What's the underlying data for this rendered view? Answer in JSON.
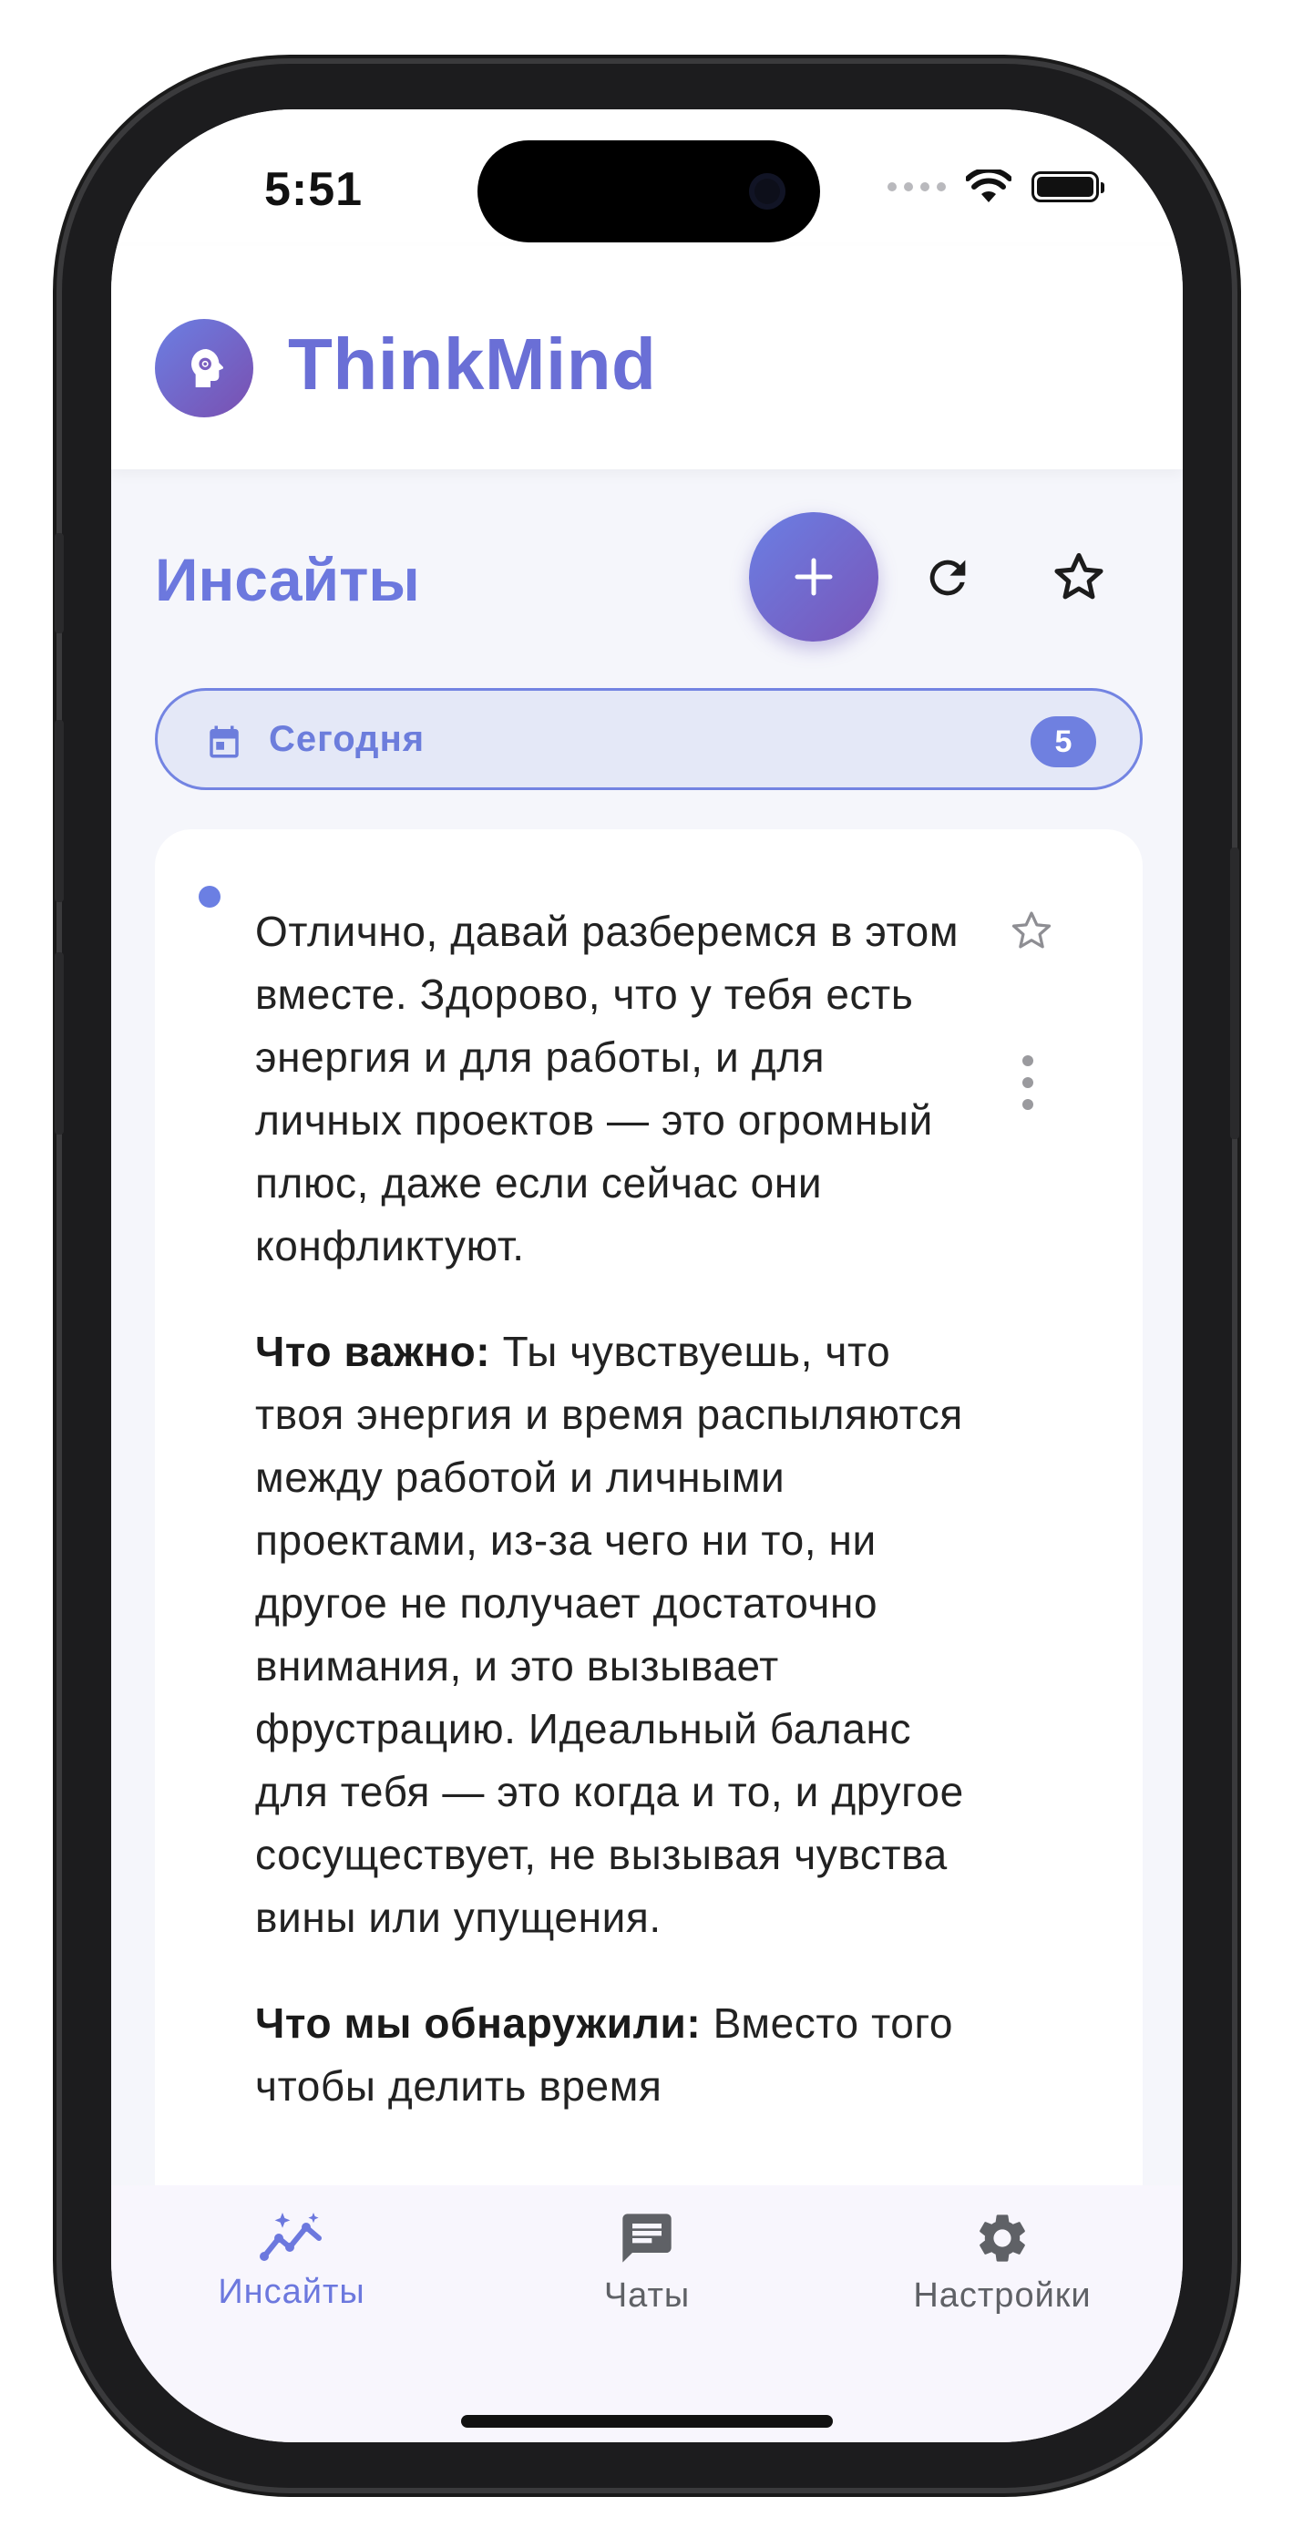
{
  "status_bar": {
    "time": "5:51"
  },
  "app": {
    "title": "ThinkMind"
  },
  "page": {
    "title": "Инсайты"
  },
  "date_filter": {
    "label": "Сегодня",
    "count": "5"
  },
  "insight": {
    "paragraphs": [
      {
        "bold": "",
        "text": "Отлично, давай разберемся в этом вместе. Здорово, что у тебя есть энергия и для работы, и для личных проектов — это огромный плюс, даже если сейчас они конфликтуют."
      },
      {
        "bold": "Что важно:",
        "text": " Ты чувствуешь, что твоя энергия и время распыляются между работой и личными проектами, из-за чего ни то, ни другое не получает достаточно внимания, и это вызывает фрустрацию. Идеальный баланс для тебя — это когда и то, и другое сосуществует, не вызывая чувства вины или упущения."
      },
      {
        "bold": "Что мы обнаружили:",
        "text": " Вместо того чтобы делить время"
      }
    ]
  },
  "nav": {
    "items": [
      {
        "label": "Инсайты",
        "icon": "insights-icon",
        "active": true
      },
      {
        "label": "Чаты",
        "icon": "chat-icon",
        "active": false
      },
      {
        "label": "Настройки",
        "icon": "gear-icon",
        "active": false
      }
    ]
  },
  "colors": {
    "accent": "#6c78de",
    "accent_dark": "#7a4fb0",
    "background": "#f5f6fb"
  }
}
